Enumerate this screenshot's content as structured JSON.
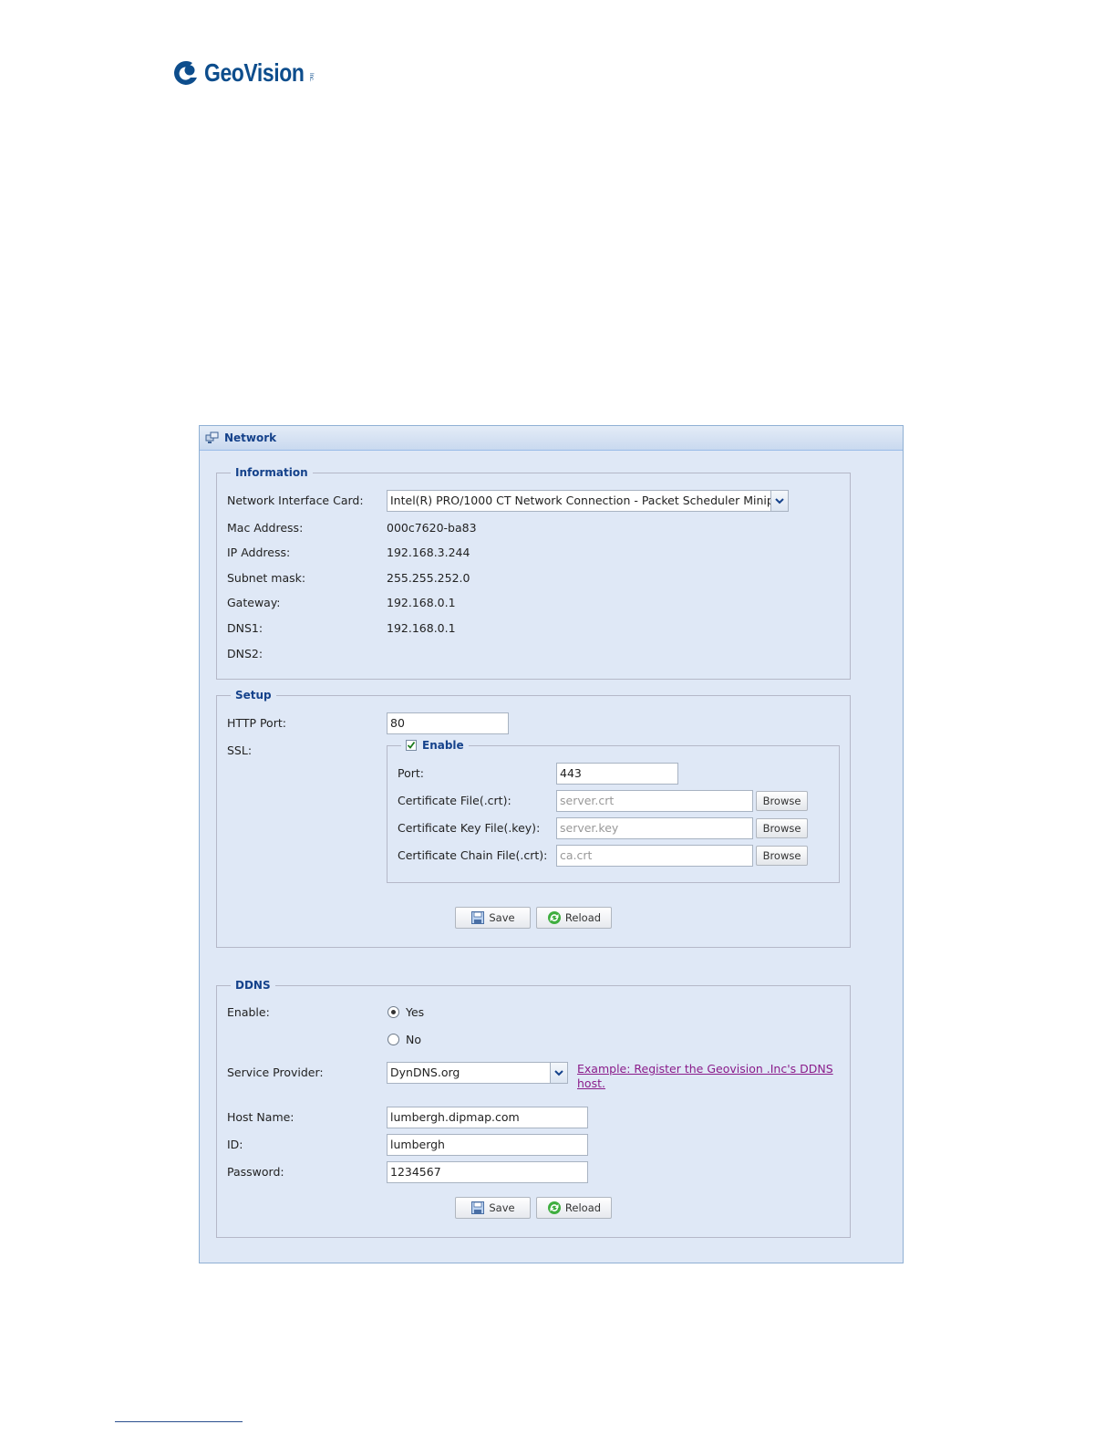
{
  "logo": {
    "name": "GeoVision",
    "inc": "Inc."
  },
  "window": {
    "title": "Network"
  },
  "information": {
    "legend": "Information",
    "nic_label": "Network Interface Card:",
    "nic_value": "Intel(R) PRO/1000 CT Network Connection - Packet Scheduler Minip",
    "rows": [
      {
        "label": "Mac Address:",
        "value": "000c7620-ba83"
      },
      {
        "label": "IP Address:",
        "value": "192.168.3.244"
      },
      {
        "label": "Subnet mask:",
        "value": "255.255.252.0"
      },
      {
        "label": "Gateway:",
        "value": "192.168.0.1"
      },
      {
        "label": "DNS1:",
        "value": "192.168.0.1"
      },
      {
        "label": "DNS2:",
        "value": ""
      }
    ]
  },
  "setup": {
    "legend": "Setup",
    "http_port_label": "HTTP Port:",
    "http_port_value": "80",
    "ssl_label": "SSL:",
    "ssl": {
      "enable_label": "Enable",
      "enabled": true,
      "port_label": "Port:",
      "port_value": "443",
      "cert_label": "Certificate File(.crt):",
      "cert_value": "server.crt",
      "key_label": "Certificate Key File(.key):",
      "key_value": "server.key",
      "chain_label": "Certificate Chain File(.crt):",
      "chain_value": "ca.crt",
      "browse_label": "Browse"
    },
    "save_label": "Save",
    "reload_label": "Reload"
  },
  "ddns": {
    "legend": "DDNS",
    "enable_label": "Enable:",
    "yes_label": "Yes",
    "no_label": "No",
    "selected": "yes",
    "provider_label": "Service Provider:",
    "provider_value": "DynDNS.org",
    "example_link_line1": "Example: Register the Geovision .Inc's DDNS",
    "example_link_line2": "host.",
    "host_label": "Host Name:",
    "host_value": "lumbergh.dipmap.com",
    "id_label": "ID:",
    "id_value": "lumbergh",
    "password_label": "Password:",
    "password_value": "1234567",
    "save_label": "Save",
    "reload_label": "Reload"
  },
  "colors": {
    "brand": "#0d4d8c",
    "panel_bg": "#dfe8f6",
    "legend": "#15428b",
    "link": "#8a1c8a"
  }
}
